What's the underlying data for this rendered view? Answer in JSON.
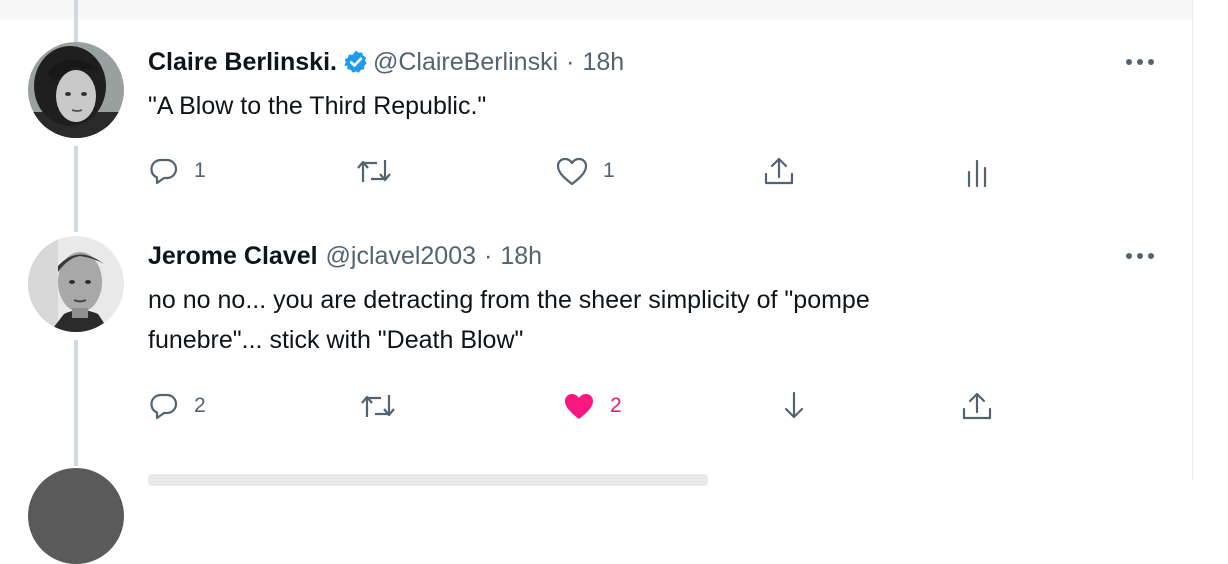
{
  "tweets": [
    {
      "author": {
        "name": "Claire Berlinski.",
        "handle": "@ClaireBerlinski",
        "verified": true,
        "avatar": "woman-portrait-avatar"
      },
      "separator": "·",
      "time": "18h",
      "lines": [
        "\"A Blow to the Third Republic.\""
      ],
      "actions": {
        "reply_count": "1",
        "retweet_count": "",
        "like_count": "1",
        "liked": false
      },
      "icons": [
        "reply-icon",
        "retweet-icon",
        "like-icon",
        "share-icon",
        "analytics-icon",
        "more-icon"
      ]
    },
    {
      "author": {
        "name": "Jerome Clavel",
        "handle": "@jclavel2003",
        "verified": false,
        "avatar": "man-portrait-avatar"
      },
      "separator": "·",
      "time": "18h",
      "lines": [
        "no no no... you are detracting from the sheer simplicity of \"pompe",
        "funebre\"... stick with \"Death Blow\""
      ],
      "actions": {
        "reply_count": "2",
        "retweet_count": "",
        "like_count": "2",
        "liked": true
      },
      "icons": [
        "reply-icon",
        "retweet-icon",
        "like-filled-icon",
        "download-icon",
        "share-icon",
        "more-icon"
      ]
    }
  ],
  "colors": {
    "text": "#0f1419",
    "secondary": "#536471",
    "verified": "#1d9bf0",
    "like": "#f91880",
    "thread_line": "#cfd9de"
  }
}
